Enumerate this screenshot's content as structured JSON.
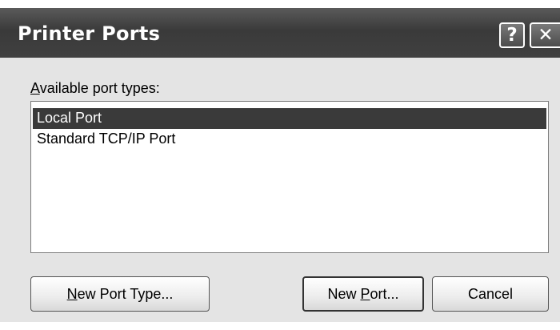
{
  "window": {
    "title": "Printer Ports",
    "help_glyph": "?",
    "close_glyph": "✕"
  },
  "label": {
    "accel": "A",
    "rest": "vailable port types:"
  },
  "port_types": [
    {
      "label": "Local Port",
      "selected": true
    },
    {
      "label": "Standard TCP/IP Port",
      "selected": false
    }
  ],
  "buttons": {
    "new_port_type": {
      "accel": "N",
      "rest": "ew Port Type..."
    },
    "new_port": {
      "pre": "New ",
      "accel": "P",
      "rest": "ort..."
    },
    "cancel": "Cancel"
  },
  "colors": {
    "titlebar": "#404040",
    "selection": "#3a3a3a",
    "dialog_bg": "#e4e4e4"
  }
}
